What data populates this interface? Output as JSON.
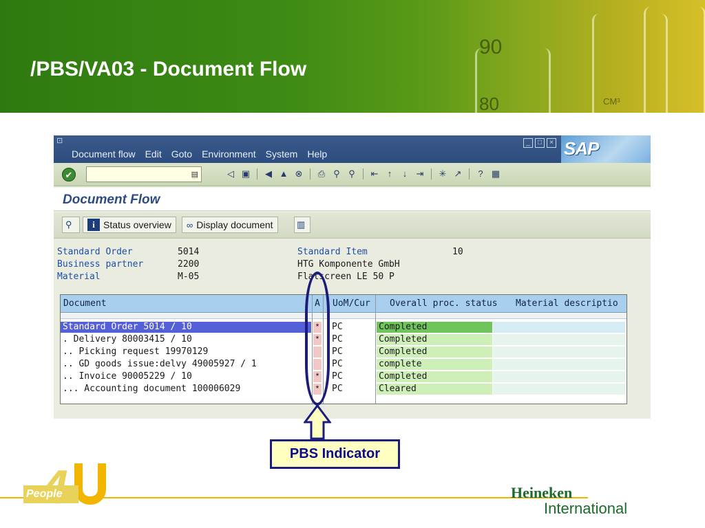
{
  "slide": {
    "title": "/PBS/VA03 - Document Flow",
    "banner_marks": {
      "m90": "90",
      "m80": "80",
      "mcm": "CM³"
    }
  },
  "sap": {
    "menu": [
      "Document flow",
      "Edit",
      "Goto",
      "Environment",
      "System",
      "Help"
    ],
    "logo": "SAP",
    "command_field": {
      "value": ""
    },
    "screen_title": "Document Flow",
    "app_toolbar": {
      "status_overview": "Status overview",
      "display_document": "Display document"
    },
    "header": {
      "standard_order_label": "Standard Order",
      "standard_order_value": "5014",
      "business_partner_label": "Business partner",
      "business_partner_value": "2200",
      "material_label": "Material",
      "material_value": "M-05",
      "standard_item_label": "Standard Item",
      "standard_item_value": "10",
      "partner_name": "HTG Komponente GmbH",
      "material_desc": "Flatscreen LE 50 P"
    },
    "grid": {
      "columns": {
        "document": "Document",
        "indicator": "A",
        "uom": "UoM/Cur",
        "status": "Overall proc. status",
        "material": "Material descriptio"
      },
      "rows": [
        {
          "document": "Standard Order 5014 / 10",
          "indicator": "*",
          "uom": "PC",
          "status": "Completed",
          "selected": true
        },
        {
          "document": ". Delivery 80003415 / 10",
          "indicator": "*",
          "uom": "PC",
          "status": "Completed"
        },
        {
          "document": ".. Picking request 19970129",
          "indicator": "",
          "uom": "PC",
          "status": "Completed"
        },
        {
          "document": ".. GD goods issue:delvy 49005927 / 1",
          "indicator": "",
          "uom": "PC",
          "status": "complete"
        },
        {
          "document": ".. Invoice 90005229 / 10",
          "indicator": "*",
          "uom": "PC",
          "status": "Completed"
        },
        {
          "document": "... Accounting document 100006029",
          "indicator": "*",
          "uom": "PC",
          "status": "Cleared"
        }
      ]
    }
  },
  "annotation": {
    "callout": "PBS Indicator"
  },
  "footer": {
    "logo_4u": {
      "digit": "4",
      "word": "People"
    },
    "company_line1": "Heineken",
    "company_line2": "International"
  },
  "colors": {
    "banner_green": "#3d8a14",
    "sap_blue": "#2d4d80",
    "selection": "#5560d8",
    "status_green": "#cfefb8",
    "indicator_red": "#f4c7c7",
    "callout_border": "#1c1c7a",
    "accent_gold": "#f2b600"
  }
}
